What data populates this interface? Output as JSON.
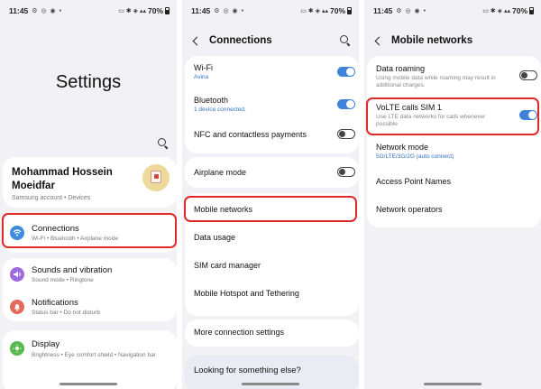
{
  "status": {
    "time": "11:45",
    "left_icons": "⚙ ◎ ◉ •",
    "right_icons": "▭ ✱ ◈ ▴▴",
    "battery": "70%"
  },
  "screen1": {
    "title": "Settings",
    "account": {
      "name": "Mohammad Hossein Moeidfar",
      "sub": "Samsung account  •  Devices"
    },
    "items": [
      {
        "title": "Connections",
        "sub": "Wi-Fi  •  Bluetooth  •  Airplane mode",
        "icon": "wifi-icon",
        "color": "#3e8ce0"
      },
      {
        "title": "Sounds and vibration",
        "sub": "Sound mode  •  Ringtone",
        "icon": "volume-icon",
        "color": "#9c6be0"
      },
      {
        "title": "Notifications",
        "sub": "Status bar  •  Do not disturb",
        "icon": "bell-icon",
        "color": "#e46a5c"
      },
      {
        "title": "Display",
        "sub": "Brightness  •  Eye comfort shield  •  Navigation bar",
        "icon": "sun-icon",
        "color": "#58b94c"
      }
    ]
  },
  "screen2": {
    "title": "Connections",
    "wifi": {
      "title": "Wi-Fi",
      "sub": "Avina",
      "on": true
    },
    "bluetooth": {
      "title": "Bluetooth",
      "sub": "1 device connected.",
      "on": true
    },
    "nfc": {
      "title": "NFC and contactless payments",
      "on": false
    },
    "airplane": {
      "title": "Airplane mode",
      "on": false
    },
    "links": [
      "Mobile networks",
      "Data usage",
      "SIM card manager",
      "Mobile Hotspot and Tethering"
    ],
    "more": "More connection settings",
    "looking": "Looking for something else?"
  },
  "screen3": {
    "title": "Mobile networks",
    "roaming": {
      "title": "Data roaming",
      "sub": "Using mobile data while roaming may result in additional charges.",
      "on": false
    },
    "volte": {
      "title": "VoLTE calls SIM 1",
      "sub": "Use LTE data networks for calls whenever possible.",
      "on": true
    },
    "network_mode": {
      "title": "Network mode",
      "sub": "5G/LTE/3G/2G (auto connect)"
    },
    "apn": "Access Point Names",
    "operators": "Network operators"
  },
  "colors": {
    "highlight": "#e02a2a",
    "toggle_on": "#3e83d9",
    "accent_text": "#2f72c9"
  }
}
